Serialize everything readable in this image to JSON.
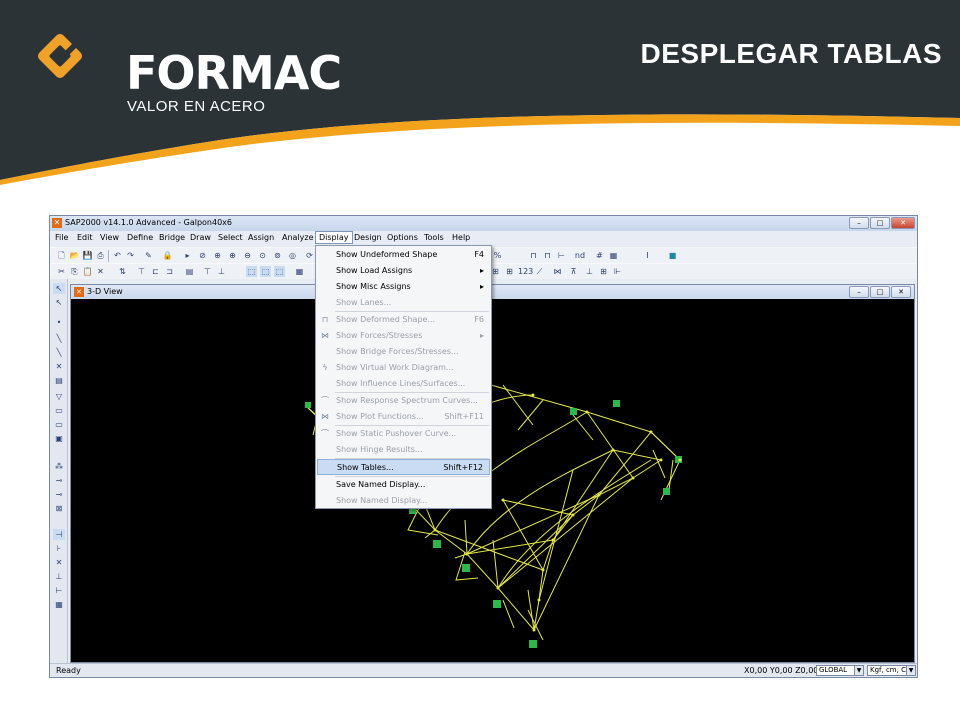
{
  "slide": {
    "brand": "FORMAC",
    "tagline": "VALOR EN ACERO",
    "title": "DESPLEGAR TABLAS"
  },
  "window": {
    "title": "SAP2000 v14.1.0 Advanced  - Galpon40x6",
    "controls": [
      "–",
      "□",
      "✕"
    ]
  },
  "menubar": [
    {
      "label": "File",
      "active": false
    },
    {
      "label": "Edit",
      "active": false
    },
    {
      "label": "View",
      "active": false
    },
    {
      "label": "Define",
      "active": false
    },
    {
      "label": "Bridge",
      "active": false
    },
    {
      "label": "Draw",
      "active": false
    },
    {
      "label": "Select",
      "active": false
    },
    {
      "label": "Assign",
      "active": false
    },
    {
      "label": "Analyze",
      "active": false
    },
    {
      "label": "Display",
      "active": true
    },
    {
      "label": "Design",
      "active": false
    },
    {
      "label": "Options",
      "active": false
    },
    {
      "label": "Tools",
      "active": false
    },
    {
      "label": "Help",
      "active": false
    }
  ],
  "display_menu": [
    {
      "label": "Show Undeformed Shape",
      "shortcut": "F4",
      "enabled": true,
      "submenu": false,
      "icon": ""
    },
    {
      "label": "Show Load Assigns",
      "shortcut": "",
      "enabled": true,
      "submenu": true,
      "icon": ""
    },
    {
      "label": "Show Misc Assigns",
      "shortcut": "",
      "enabled": true,
      "submenu": true,
      "icon": ""
    },
    {
      "label": "Show Lanes...",
      "shortcut": "",
      "enabled": false,
      "submenu": false,
      "icon": ""
    },
    {
      "label": "Show  Deformed Shape...",
      "shortcut": "F6",
      "enabled": false,
      "submenu": false,
      "icon": "deformed-shape-icon"
    },
    {
      "label": "Show Forces/Stresses",
      "shortcut": "",
      "enabled": false,
      "submenu": true,
      "icon": "forces-icon"
    },
    {
      "label": "Show Bridge Forces/Stresses...",
      "shortcut": "",
      "enabled": false,
      "submenu": false,
      "icon": ""
    },
    {
      "label": "Show Virtual Work Diagram...",
      "shortcut": "",
      "enabled": false,
      "submenu": false,
      "icon": "lightning-icon"
    },
    {
      "label": "Show Influence Lines/Surfaces...",
      "shortcut": "",
      "enabled": false,
      "submenu": false,
      "icon": ""
    },
    {
      "label": "Show Response Spectrum Curves...",
      "shortcut": "",
      "enabled": false,
      "submenu": false,
      "icon": "spectrum-curve-icon"
    },
    {
      "label": "Show Plot Functions...",
      "shortcut": "Shift+F11",
      "enabled": false,
      "submenu": false,
      "icon": "plot-functions-icon"
    },
    {
      "label": "Show Static Pushover Curve...",
      "shortcut": "",
      "enabled": false,
      "submenu": false,
      "icon": "pushover-curve-icon"
    },
    {
      "label": "Show Hinge Results...",
      "shortcut": "",
      "enabled": false,
      "submenu": false,
      "icon": ""
    },
    {
      "label": "Show Tables...",
      "shortcut": "Shift+F12",
      "enabled": true,
      "submenu": false,
      "icon": "",
      "highlighted": true
    },
    {
      "label": "Save Named Display...",
      "shortcut": "",
      "enabled": true,
      "submenu": false,
      "icon": ""
    },
    {
      "label": "Show Named Display...",
      "shortcut": "",
      "enabled": false,
      "submenu": false,
      "icon": ""
    }
  ],
  "view": {
    "title": "3-D View"
  },
  "statusbar": {
    "status": "Ready",
    "coords": "X0,00  Y0,00  Z0,00",
    "coord_system": "GLOBAL",
    "units": "Kgf, cm, C"
  },
  "colors": {
    "header_dark": "#2b3337",
    "accent_orange": "#f3a21c",
    "frame_yellow": "#e6e64a",
    "support_green": "#2fb84a",
    "menu_highlight": "#c9dcf3"
  }
}
